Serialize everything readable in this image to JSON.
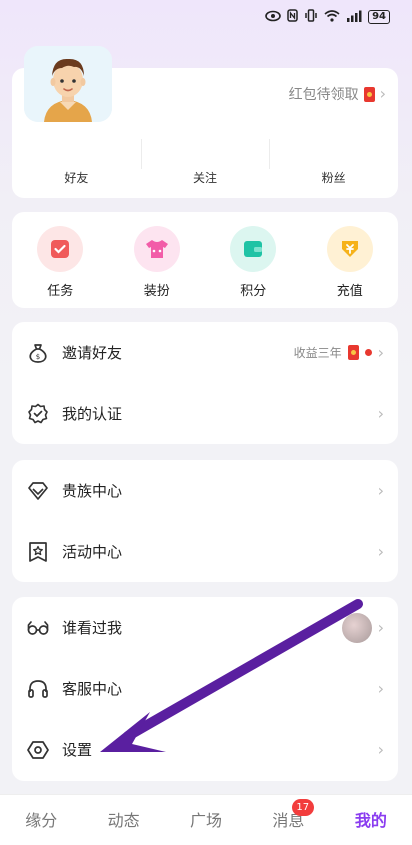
{
  "status_bar": {
    "battery": "94"
  },
  "profile": {
    "hongbao_label": "红包待领取",
    "stats": [
      {
        "label": "好友"
      },
      {
        "label": "关注"
      },
      {
        "label": "粉丝"
      }
    ]
  },
  "quick_actions": [
    {
      "label": "任务",
      "icon": "task-icon",
      "color": "#f05a5a"
    },
    {
      "label": "装扮",
      "icon": "dress-up-icon",
      "color": "#f25ca8"
    },
    {
      "label": "积分",
      "icon": "points-wallet-icon",
      "color": "#1fc3a5"
    },
    {
      "label": "充值",
      "icon": "recharge-coin-icon",
      "color": "#f6b21a"
    }
  ],
  "menu_groups": [
    [
      {
        "label": "邀请好友",
        "icon": "money-bag-icon",
        "right_text": "收益三年"
      },
      {
        "label": "我的认证",
        "icon": "verified-badge-icon"
      }
    ],
    [
      {
        "label": "贵族中心",
        "icon": "diamond-icon"
      },
      {
        "label": "活动中心",
        "icon": "star-flag-icon"
      }
    ],
    [
      {
        "label": "谁看过我",
        "icon": "glasses-icon"
      },
      {
        "label": "客服中心",
        "icon": "headset-icon"
      },
      {
        "label": "设置",
        "icon": "settings-hexagon-icon"
      }
    ]
  ],
  "tabbar": {
    "tabs": [
      {
        "label": "缘分"
      },
      {
        "label": "动态"
      },
      {
        "label": "广场"
      },
      {
        "label": "消息",
        "badge": "17"
      },
      {
        "label": "我的",
        "active": true
      }
    ]
  },
  "colors": {
    "accent": "#8a3cf0",
    "annotation_arrow": "#5a1fa0"
  }
}
